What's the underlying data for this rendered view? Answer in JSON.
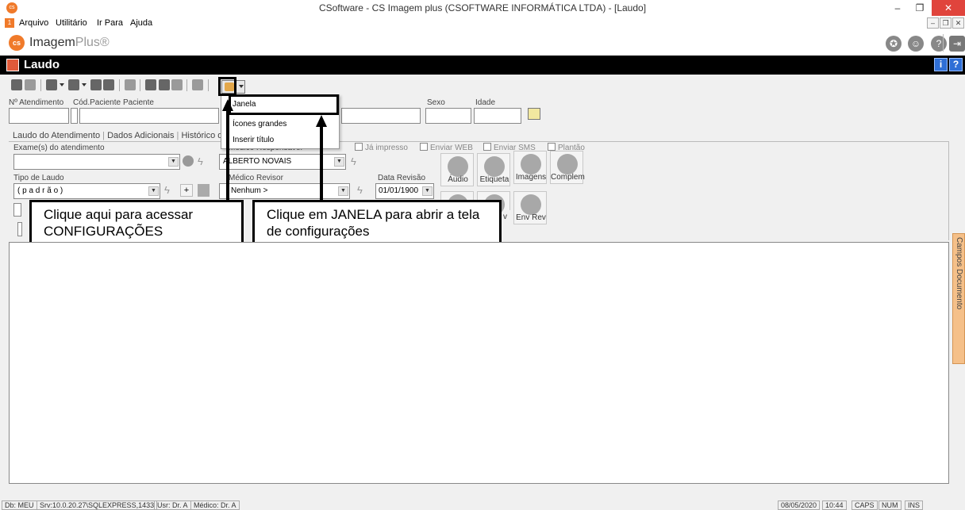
{
  "window": {
    "title": "CSoftware - CS Imagem plus (CSOFTWARE INFORMÁTICA LTDA) - [Laudo]",
    "app_icon_text": "cs"
  },
  "menubar": {
    "items": [
      "Arquivo",
      "Utilitário",
      "Ir Para",
      "Ajuda"
    ]
  },
  "brand": {
    "logo": "cs",
    "name": "Imagem",
    "plus": "Plus®"
  },
  "section": {
    "title": "Laudo"
  },
  "form": {
    "labels": {
      "atendimento": "Nº Atendimento",
      "cod_paciente": "Cód.Paciente",
      "paciente": "Paciente",
      "sexo": "Sexo",
      "idade": "Idade",
      "exames": "Exame(s) do atendimento",
      "medico_resp": "Médico Responsável",
      "tipo_laudo": "Tipo de Laudo",
      "medico_revisor": "Médico Revisor",
      "data_revisao": "Data Revisão"
    },
    "values": {
      "medico_resp": "ALBERTO NOVAIS",
      "tipo_laudo": "( p a d r ã o )",
      "medico_revisor": "Nenhum >",
      "data_revisao": "01/01/1900"
    },
    "checkboxes": [
      "Já impresso",
      "Enviar WEB",
      "Enviar SMS",
      "Plantão"
    ],
    "circle_buttons": [
      "Áudio",
      "Etiqueta",
      "Imagens",
      "Complem",
      "Env Rev"
    ],
    "partial_label": "v"
  },
  "tabs": [
    "Laudo do Atendimento",
    "Dados Adicionais",
    "Histórico do Pa"
  ],
  "dropdown": {
    "items": [
      "Janela",
      "Ícones grandes",
      "Inserir título"
    ]
  },
  "annotations": {
    "left": "Clique aqui para acessar CONFIGURAÇÕES",
    "right": "Clique em JANELA para abrir a tela de configurações"
  },
  "side_tab": "Campos Documento",
  "statusbar": {
    "db": "Db: MEU",
    "srv": "Srv:10.0.20.27\\SQLEXPRESS,1433",
    "usr": "Usr: Dr. A",
    "medico": "Médico: Dr. A",
    "date": "08/05/2020",
    "time": "10:44",
    "caps": "CAPS",
    "num": "NUM",
    "ins": "INS"
  },
  "colors": {
    "accent": "#f07a2a",
    "section_bar": "#000000",
    "close": "#e0443c",
    "side_tab": "#f5c089"
  }
}
